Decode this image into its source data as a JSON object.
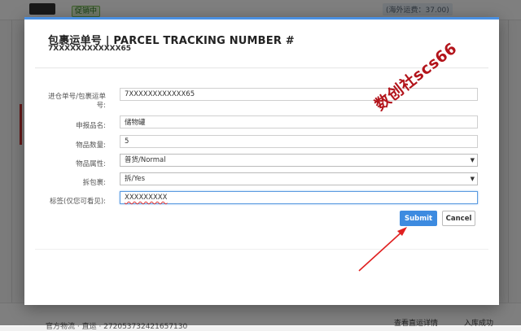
{
  "background": {
    "badge": "促销中",
    "shipping_fee": "(海外运费：37.00)",
    "tracking_text": "官方物流 · 直运 · 272053732421657130",
    "view_detail": "查看直运详情",
    "status": "入库成功",
    "dots": "● ●"
  },
  "modal": {
    "title": "包裹运单号 | PARCEL TRACKING NUMBER #",
    "subtitle": "7XXXXXXXXXXXX65",
    "fields": [
      {
        "label": "进仓单号/包裹运单号:",
        "value": "7XXXXXXXXXXXX65"
      },
      {
        "label": "申报品名:",
        "value": "储物罐"
      },
      {
        "label": "物品数量:",
        "value": "5"
      },
      {
        "label": "物品属性:",
        "value": "普货/Normal"
      },
      {
        "label": "拆包裹:",
        "value": "拆/Yes"
      },
      {
        "label": "标签(仅您可看见):",
        "value": "XXXXXXXXX"
      }
    ],
    "submit_label": "Submit",
    "cancel_label": "Cancel"
  },
  "watermark": "数创社scs66",
  "colors": {
    "accent": "#3d8be0",
    "modal_top_border": "#4a90e2",
    "annotation_red": "#e02020",
    "watermark": "#b3141b"
  },
  "icons": {
    "select_caret": "▼"
  }
}
